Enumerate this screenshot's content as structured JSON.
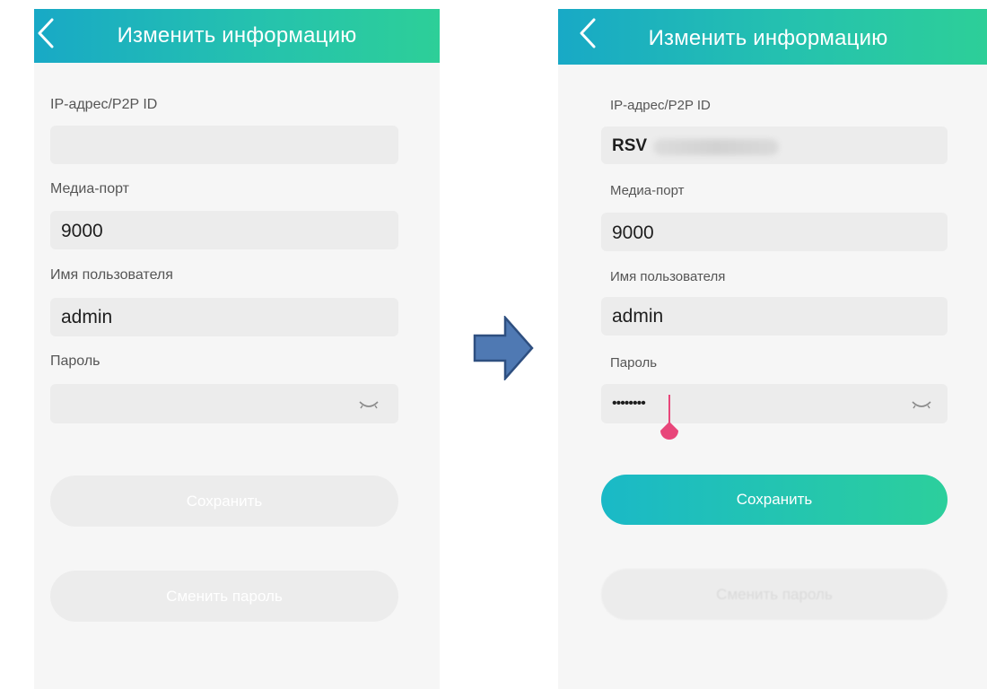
{
  "left_screen": {
    "header": {
      "title": "Изменить информацию",
      "back_icon": "chevron-left-icon"
    },
    "fields": [
      {
        "label": "IP-адрес/P2P ID",
        "value": ""
      },
      {
        "label": "Медиа-порт",
        "value": "9000"
      },
      {
        "label": "Имя пользователя",
        "value": "admin"
      },
      {
        "label": "Пароль",
        "value": "",
        "toggle_icon": "eye-closed-icon"
      }
    ],
    "save_label": "Сохранить",
    "save_enabled": false,
    "change_password_label": "Сменить пароль"
  },
  "right_screen": {
    "header": {
      "title": "Изменить информацию",
      "back_icon": "chevron-left-icon"
    },
    "fields": [
      {
        "label": "IP-адрес/P2P ID",
        "value": "RSV"
      },
      {
        "label": "Медиа-порт",
        "value": "9000"
      },
      {
        "label": "Имя пользователя",
        "value": "admin"
      },
      {
        "label": "Пароль",
        "value": "••••••••",
        "toggle_icon": "eye-closed-icon"
      }
    ],
    "save_label": "Сохранить",
    "save_enabled": true,
    "change_password_label": "Сменить пароль"
  },
  "transition_icon": "arrow-right-icon",
  "colors": {
    "header_start": "#18a9c6",
    "header_end": "#2dcf98",
    "button_start": "#1ab9c7",
    "button_end": "#2ccf9c",
    "field_bg": "#ececec",
    "screen_bg": "#f6f6f6",
    "caret": "#e8467a",
    "arrow_fill": "#4f79b3",
    "arrow_stroke": "#2e4f80"
  }
}
